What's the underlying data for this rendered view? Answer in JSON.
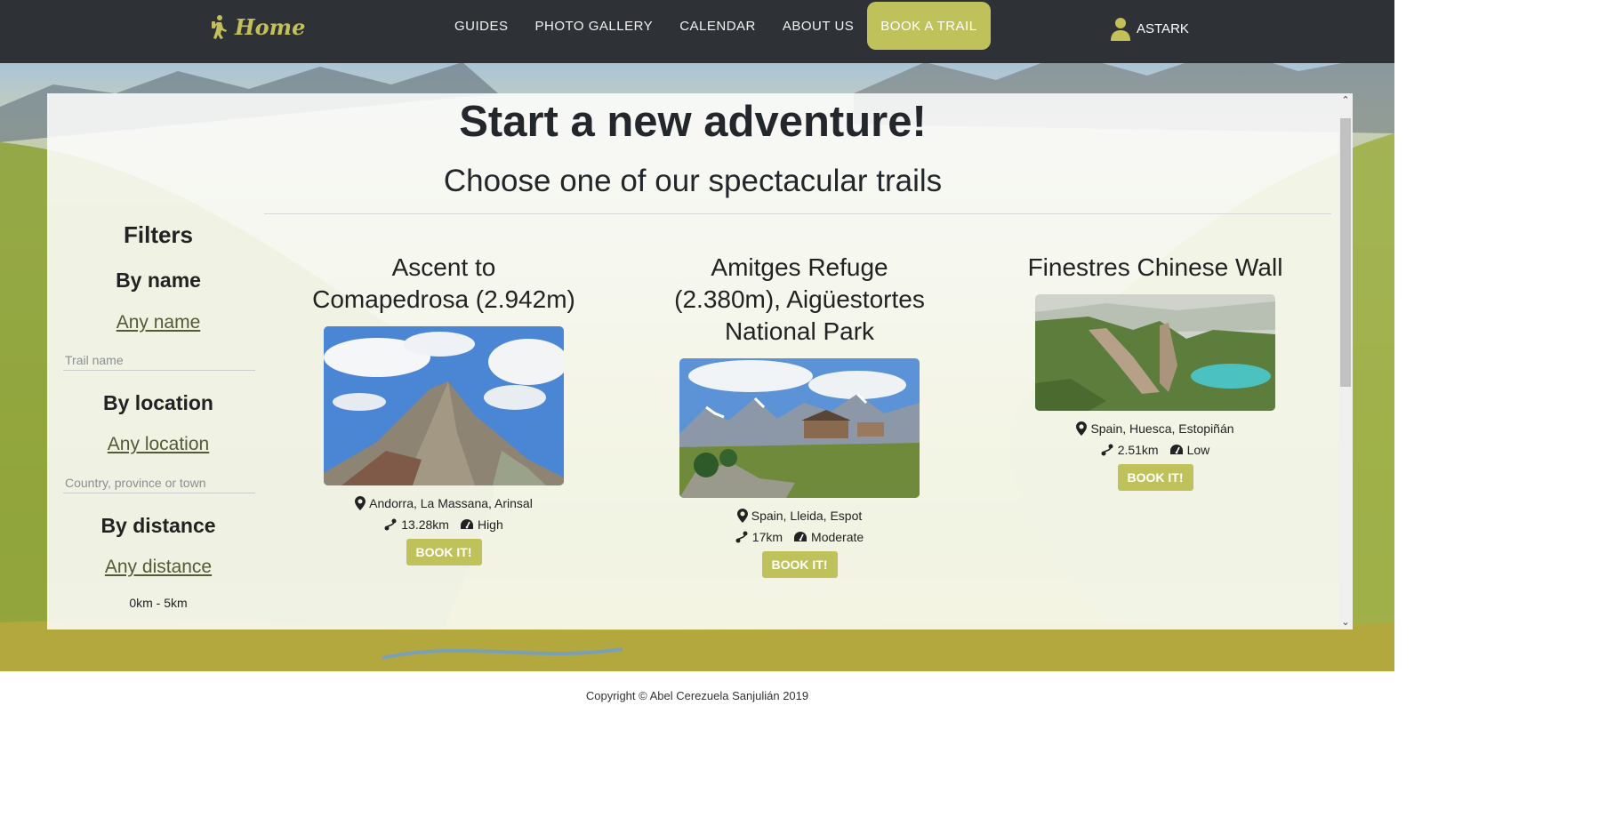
{
  "nav": {
    "brand": "Home",
    "links": [
      "GUIDES",
      "PHOTO GALLERY",
      "CALENDAR",
      "ABOUT US"
    ],
    "cta": "BOOK A TRAIL",
    "user": "ASTARK"
  },
  "hero": {
    "title": "Start a new adventure!",
    "subtitle": "Choose one of our spectacular trails"
  },
  "filters": {
    "title": "Filters",
    "by_name": {
      "heading": "By name",
      "link": "Any name",
      "placeholder": "Trail name"
    },
    "by_location": {
      "heading": "By location",
      "link": "Any location",
      "placeholder": "Country, province or town"
    },
    "by_distance": {
      "heading": "By distance",
      "link": "Any distance",
      "options": [
        "0km - 5km"
      ]
    }
  },
  "trails": [
    {
      "title": "Ascent to Comapedrosa (2.942m)",
      "location": "Andorra, La Massana, Arinsal",
      "distance": "13.28km",
      "difficulty": "High",
      "button": "BOOK IT!"
    },
    {
      "title": "Amitges Refuge (2.380m), Aigüestortes National Park",
      "location": "Spain, Lleida, Espot",
      "distance": "17km",
      "difficulty": "Moderate",
      "button": "BOOK IT!"
    },
    {
      "title": "Finestres Chinese Wall",
      "location": "Spain, Huesca, Estopiñán",
      "distance": "2.51km",
      "difficulty": "Low",
      "button": "BOOK IT!"
    }
  ],
  "footer": {
    "copyright": "Copyright © Abel Cerezuela Sanjulián 2019"
  },
  "colors": {
    "accent": "#bfc25b",
    "navbar": "#2e3136",
    "brand": "#c3c05a"
  }
}
